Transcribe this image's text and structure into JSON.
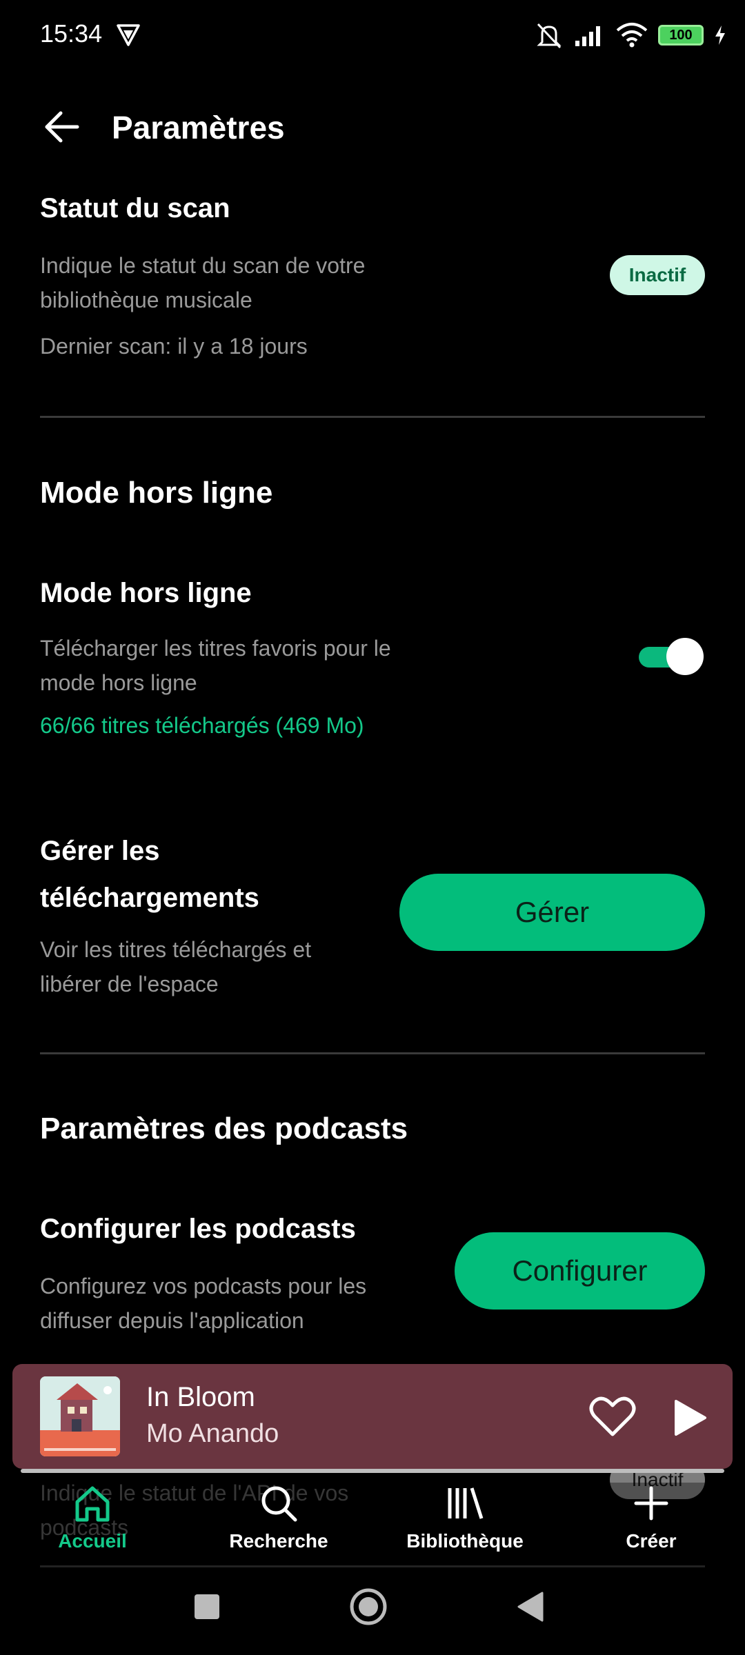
{
  "status_bar": {
    "time": "15:34",
    "battery": "100"
  },
  "header": {
    "title": "Paramètres"
  },
  "scan": {
    "title": "Statut du scan",
    "description": "Indique le statut du scan de votre bibliothèque musicale",
    "last_scan": "Dernier scan: il y a 18 jours",
    "badge": "Inactif"
  },
  "offline": {
    "section_title": "Mode hors ligne",
    "item_title": "Mode hors ligne",
    "description": "Télécharger les titres favoris pour le mode hors ligne",
    "status": "66/66 titres téléchargés (469 Mo)",
    "toggle_on": true
  },
  "downloads": {
    "title": "Gérer les téléchargements",
    "description": "Voir les titres téléchargés et libérer de l'espace",
    "button": "Gérer"
  },
  "podcasts": {
    "section_title": "Paramètres des podcasts",
    "item_title": "Configurer les podcasts",
    "description": "Configurez vos podcasts pour les diffuser depuis l'application",
    "button": "Configurer",
    "api_description": "Indique le statut de l'API de vos podcasts",
    "api_badge": "Inactif"
  },
  "player": {
    "title": "In Bloom",
    "artist": "Mo Anando"
  },
  "nav": {
    "items": [
      {
        "label": "Accueil",
        "icon": "home-icon",
        "active": true
      },
      {
        "label": "Recherche",
        "icon": "search-icon",
        "active": false
      },
      {
        "label": "Bibliothèque",
        "icon": "library-icon",
        "active": false
      },
      {
        "label": "Créer",
        "icon": "plus-icon",
        "active": false
      }
    ]
  },
  "colors": {
    "accent": "#03bd7b",
    "background": "#000000",
    "player": "#6a3540"
  }
}
